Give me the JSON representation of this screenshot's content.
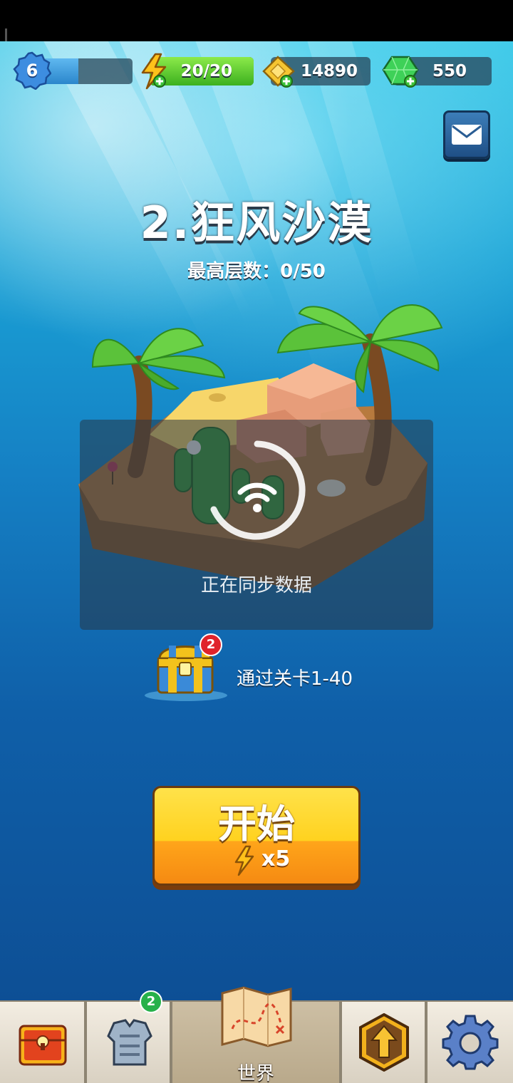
{
  "hud": {
    "level": "6",
    "xp_fraction": 0.4,
    "energy": "20/20",
    "energy_fraction": 1.0,
    "coins": "14890",
    "gems": "550"
  },
  "world": {
    "title": "2.狂风沙漠",
    "best_floors": "最高层数：0/50"
  },
  "sync": {
    "text": "正在同步数据"
  },
  "reward": {
    "badge_count": "2",
    "text": "通过关卡1-40"
  },
  "start": {
    "label": "开始",
    "cost": "x5"
  },
  "nav": {
    "equipment_badge": "2",
    "world_label": "世界"
  },
  "colors": {
    "energy_green": "#3cb01f",
    "start_yellow": "#ffd21f",
    "start_orange": "#f58a12",
    "badge_red": "#e0232b",
    "badge_green": "#27b14a"
  },
  "icons": [
    "level-badge-icon",
    "lightning-icon",
    "gold-icon",
    "gem-icon",
    "mail-icon",
    "wifi-sync-icon",
    "treasure-chest-icon",
    "chest-nav-icon",
    "armor-icon",
    "map-icon",
    "upgrade-arrow-icon",
    "gear-icon"
  ]
}
